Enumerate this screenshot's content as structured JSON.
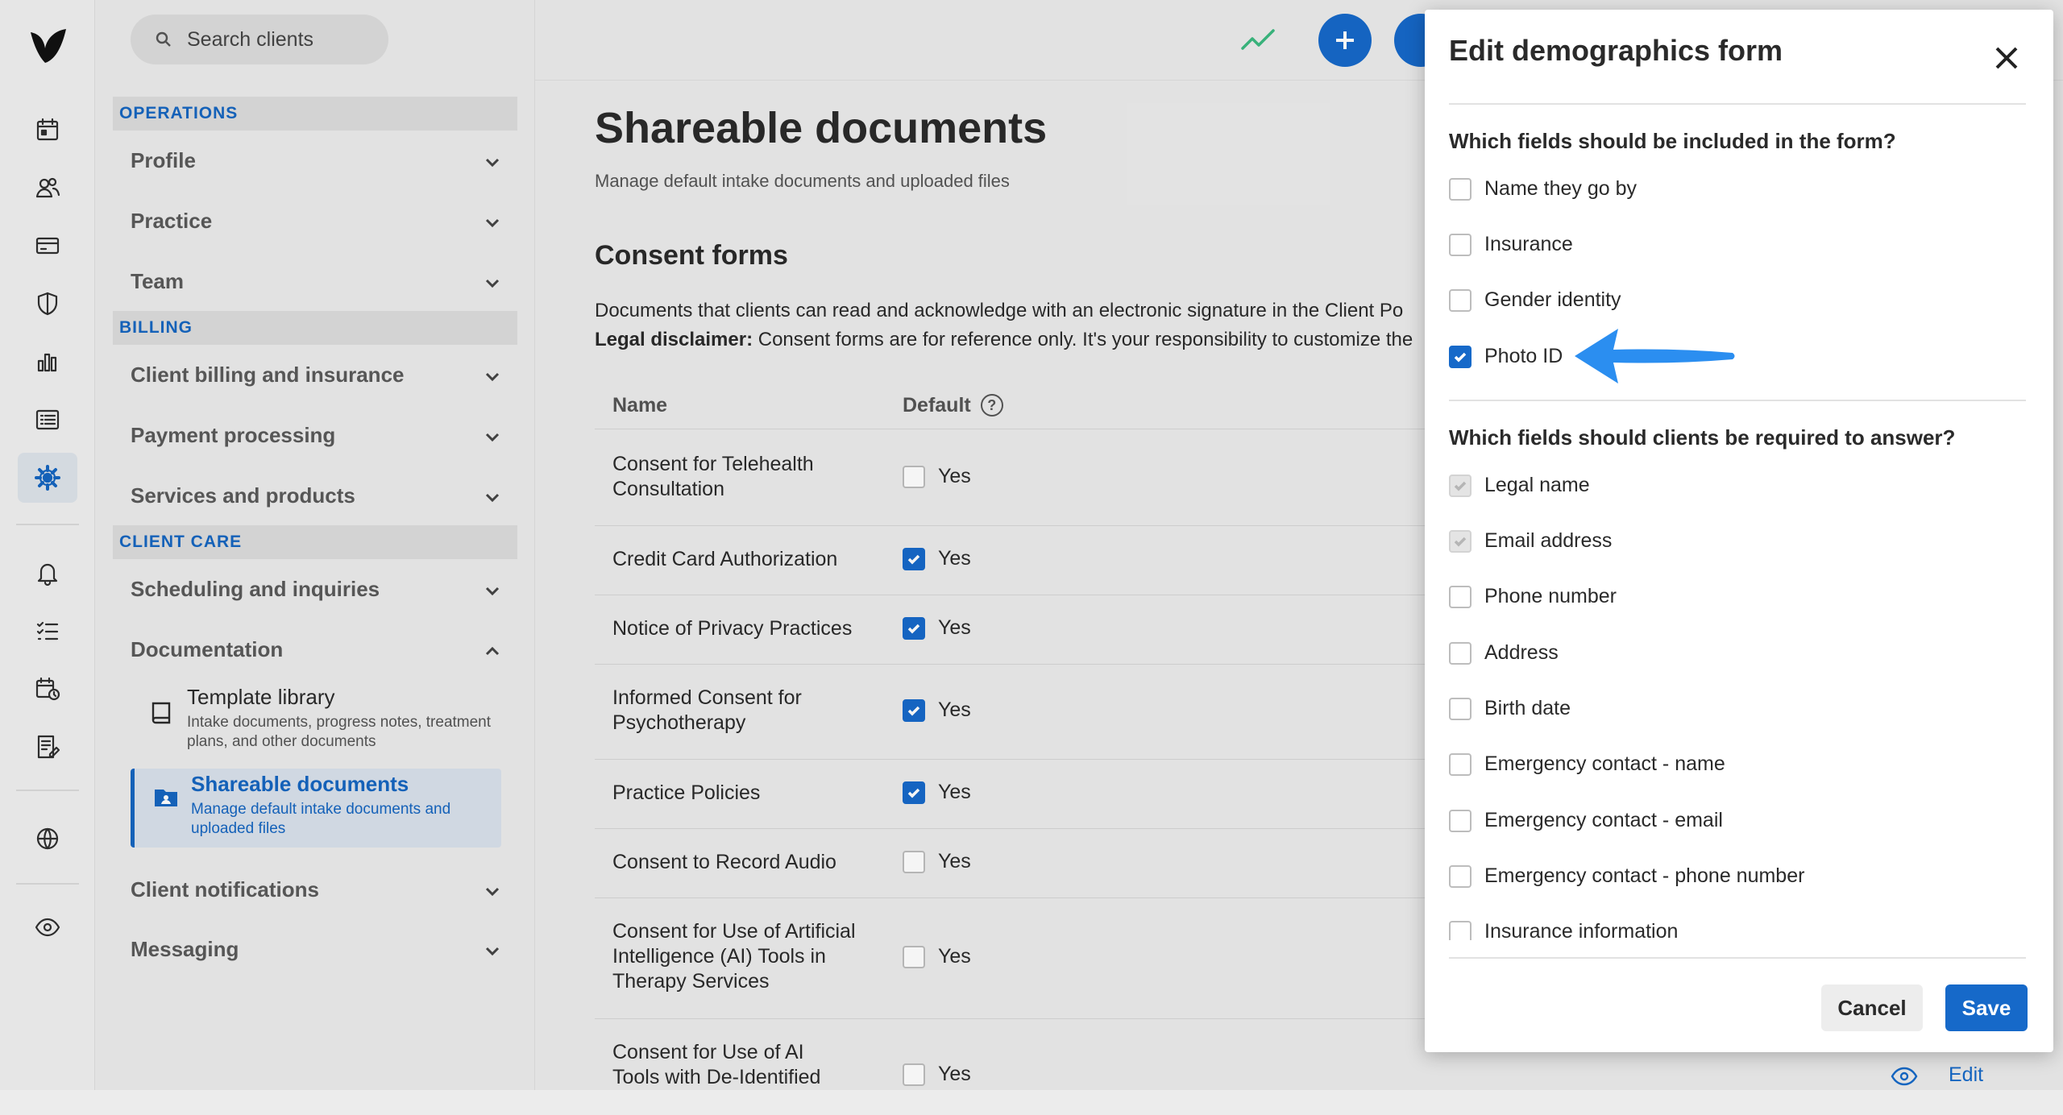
{
  "search": {
    "placeholder": "Search clients"
  },
  "rail": {
    "icons": [
      "calendar-icon",
      "clients-icon",
      "billing-card-icon",
      "shield-icon",
      "analytics-icon",
      "list-icon",
      "gear-icon",
      "bell-icon",
      "checklist-icon",
      "calendar-clock-icon",
      "notes-icon",
      "globe-icon",
      "eye-icon"
    ]
  },
  "sidebar": {
    "sections": [
      {
        "label": "OPERATIONS"
      },
      {
        "label": "BILLING"
      },
      {
        "label": "CLIENT CARE"
      }
    ],
    "items": [
      {
        "label": "Profile"
      },
      {
        "label": "Practice"
      },
      {
        "label": "Team"
      },
      {
        "label": "Client billing and insurance"
      },
      {
        "label": "Payment processing"
      },
      {
        "label": "Services and products"
      },
      {
        "label": "Scheduling and inquiries"
      },
      {
        "label": "Documentation"
      },
      {
        "label": "Client notifications"
      },
      {
        "label": "Messaging"
      }
    ],
    "subitems": [
      {
        "title": "Template library",
        "desc": "Intake documents, progress notes, treatment plans, and other documents"
      },
      {
        "title": "Shareable documents",
        "desc": "Manage default intake documents and uploaded files"
      }
    ]
  },
  "main": {
    "title": "Shareable documents",
    "subtitle": "Manage default intake documents and uploaded files",
    "section_title": "Consent forms",
    "desc_line1": "Documents that clients can read and acknowledge with an electronic signature in the Client Po",
    "desc_bold": "Legal disclaimer:",
    "desc_line2": " Consent forms are for reference only. It's your responsibility to customize the",
    "table": {
      "headers": {
        "name": "Name",
        "default": "Default"
      },
      "default_label": "Yes",
      "rows": [
        {
          "name": "Consent for Telehealth Consultation",
          "default": false
        },
        {
          "name": "Credit Card Authorization",
          "default": true
        },
        {
          "name": "Notice of Privacy Practices",
          "default": true
        },
        {
          "name": "Informed Consent for Psychotherapy",
          "default": true
        },
        {
          "name": "Practice Policies",
          "default": true
        },
        {
          "name": "Consent to Record Audio",
          "default": false
        },
        {
          "name": "Consent for Use of Artificial Intelligence (AI) Tools in Therapy Services",
          "default": false
        },
        {
          "name": "Consent for Use of AI Tools with De-Identified",
          "default": false
        }
      ]
    },
    "edit_link": "Edit"
  },
  "panel": {
    "title": "Edit demographics form",
    "q1": "Which fields should be included in the form?",
    "included": [
      {
        "label": "Name they go by",
        "checked": false
      },
      {
        "label": "Insurance",
        "checked": false
      },
      {
        "label": "Gender identity",
        "checked": false
      },
      {
        "label": "Photo ID",
        "checked": true
      }
    ],
    "q2": "Which fields should clients be required to answer?",
    "required": [
      {
        "label": "Legal name",
        "checked": true,
        "disabled": true
      },
      {
        "label": "Email address",
        "checked": true,
        "disabled": true
      },
      {
        "label": "Phone number",
        "checked": false
      },
      {
        "label": "Address",
        "checked": false
      },
      {
        "label": "Birth date",
        "checked": false
      },
      {
        "label": "Emergency contact - name",
        "checked": false
      },
      {
        "label": "Emergency contact - email",
        "checked": false
      },
      {
        "label": "Emergency contact - phone number",
        "checked": false
      },
      {
        "label": "Insurance information",
        "checked": false
      }
    ],
    "cancel_label": "Cancel",
    "save_label": "Save"
  },
  "colors": {
    "accent": "#1669c9",
    "arrow": "#2b8ef0"
  }
}
